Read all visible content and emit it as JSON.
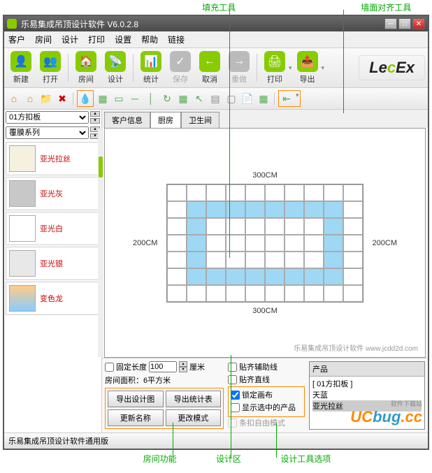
{
  "annotations": {
    "fill_tool": "填充工具",
    "wall_align_tool": "墙面对齐工具",
    "room_func": "房间功能",
    "design_area": "设计区",
    "design_options": "设计工具选项"
  },
  "title": "乐易集成吊顶设计软件  V6.0.2.8",
  "menus": [
    "客户",
    "房间",
    "设计",
    "打印",
    "设置",
    "帮助",
    "链接"
  ],
  "toolbar": [
    {
      "label": "新建",
      "icon": "👤"
    },
    {
      "label": "打开",
      "icon": "👥"
    },
    {
      "label": "房间",
      "icon": "🏠"
    },
    {
      "label": "设计",
      "icon": "📡"
    },
    {
      "label": "统计",
      "icon": "📊"
    },
    {
      "label": "保存",
      "icon": "✓",
      "disabled": true
    },
    {
      "label": "取消",
      "icon": "←"
    },
    {
      "label": "重做",
      "icon": "→",
      "disabled": true
    },
    {
      "label": "打印",
      "icon": "🖨"
    },
    {
      "label": "导出",
      "icon": "📤"
    }
  ],
  "logo_a": "Le",
  "logo_b": "c",
  "logo_c": "Ex",
  "sidebar": {
    "select1": "01方扣板",
    "select2": "覆膜系列",
    "materials": [
      {
        "name": "亚光拉丝",
        "color": "#f5f0e0"
      },
      {
        "name": "亚光灰",
        "color": "#c8c8c8"
      },
      {
        "name": "亚光白",
        "color": "#ffffff"
      },
      {
        "name": "亚光银",
        "color": "#e8e8e8"
      },
      {
        "name": "变色龙",
        "color": "linear-gradient(#fc8,#8cf)"
      }
    ]
  },
  "tabs": [
    "客户信息",
    "厨房",
    "卫生间"
  ],
  "active_tab": 1,
  "grid": {
    "width_label": "300CM",
    "height_label": "200CM",
    "cols": 10,
    "rows": 7
  },
  "watermark": "乐易集成吊顶设计软件 www.jcdd2d.com",
  "bottom": {
    "fixed_length": "固定长度",
    "length_val": "100",
    "unit": "厘米",
    "area": "房间面积：6平方米",
    "export_design": "导出设计图",
    "export_stats": "导出统计表",
    "update_name": "更新名称",
    "change_mode": "更改模式",
    "align_guide": "贴齐辅助线",
    "align_line": "贴齐直线",
    "lock_canvas": "锁定画布",
    "show_selected": "显示选中的产品",
    "strip_mode": "条扣自由模式"
  },
  "products": {
    "header": "产品",
    "items": [
      "[ 01方扣板 ]",
      "天蓝",
      "亚光拉丝"
    ]
  },
  "status": "乐易集成吊顶设计软件通用版",
  "ucbug": {
    "a": "UC",
    "b": "bug",
    "c": ".cc",
    "sub": "软件下载站"
  }
}
